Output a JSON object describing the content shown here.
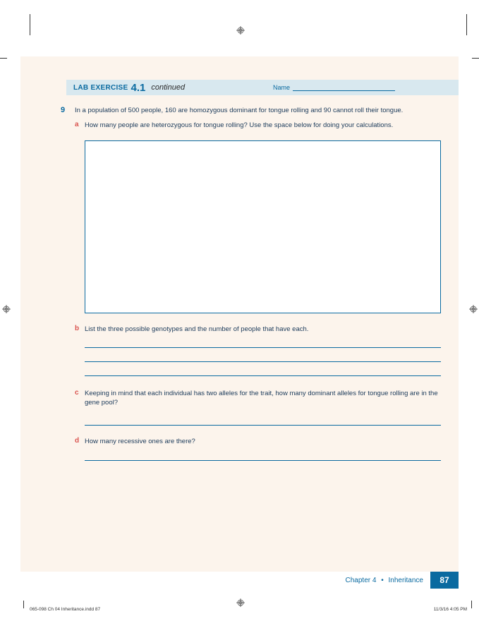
{
  "header": {
    "lab_exercise_label": "LAB EXERCISE",
    "lab_number": "4.1",
    "continued": "continued",
    "name_label": "Name"
  },
  "question": {
    "number": "9",
    "text": "In a population of 500 people, 160 are homozygous dominant for tongue rolling and 90 cannot roll their tongue.",
    "parts": {
      "a": {
        "letter": "a",
        "text": "How many people are heterozygous for tongue rolling? Use the space below for doing your calculations."
      },
      "b": {
        "letter": "b",
        "text": "List the three possible genotypes and the number of people that have each."
      },
      "c": {
        "letter": "c",
        "text": "Keeping in mind that each individual has two alleles for the trait, how many dominant alleles for tongue rolling are in the gene pool?"
      },
      "d": {
        "letter": "d",
        "text": "How many recessive ones are there?"
      }
    }
  },
  "footer": {
    "chapter_label": "Chapter 4",
    "chapter_title": "Inheritance",
    "page_number": "87"
  },
  "indesign": {
    "file_info": "065-098 Ch 04 Inheritance.indd   87",
    "timestamp": "11/3/16   4:05 PM"
  }
}
